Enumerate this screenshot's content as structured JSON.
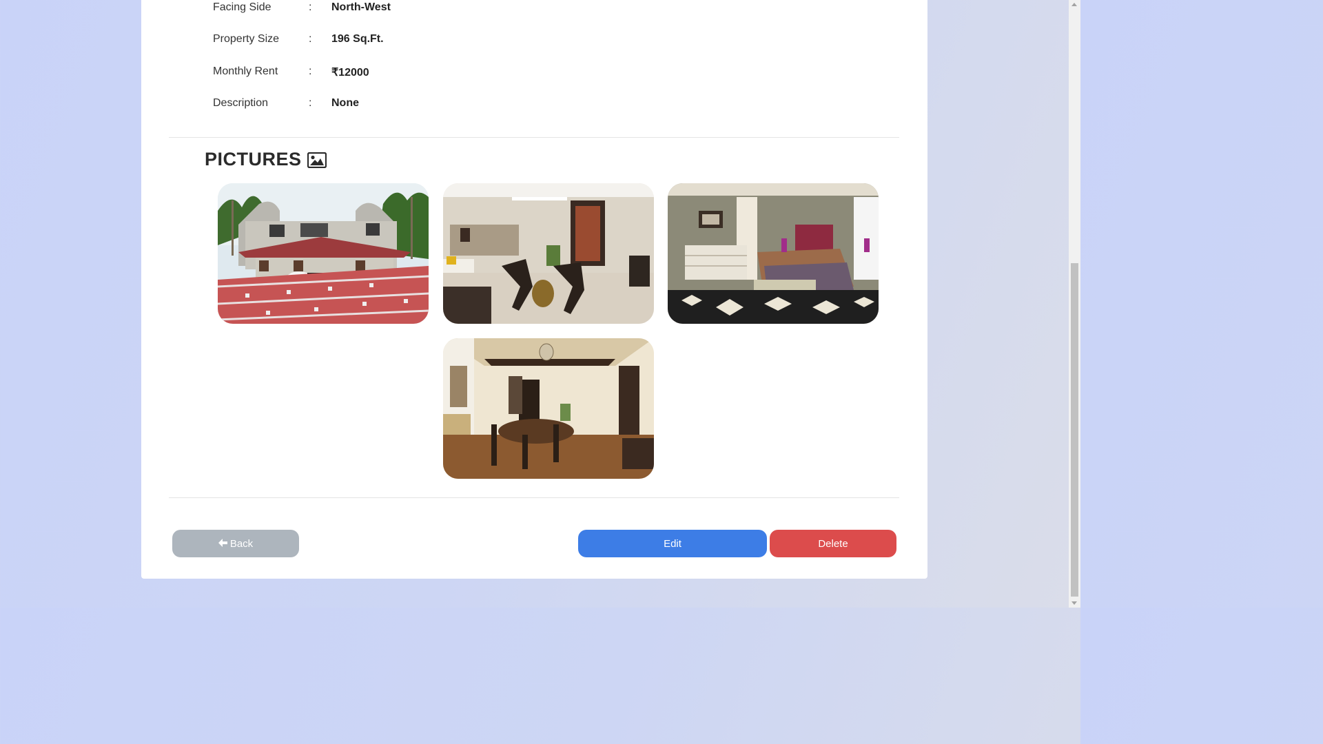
{
  "details": [
    {
      "label": "Facing Side",
      "colon": ":",
      "value": "North-West"
    },
    {
      "label": "Property Size",
      "colon": ":",
      "value": "196 Sq.Ft."
    },
    {
      "label": "Monthly Rent",
      "colon": ":",
      "value": "₹12000"
    },
    {
      "label": "Description",
      "colon": ":",
      "value": "None"
    }
  ],
  "pictures": {
    "title": "PICTURES",
    "icon": "image-icon",
    "images": [
      {
        "name": "house-exterior-photo"
      },
      {
        "name": "living-room-photo"
      },
      {
        "name": "bedroom-photo"
      },
      {
        "name": "dining-room-photo"
      }
    ]
  },
  "actions": {
    "back_label": "Back",
    "back_icon": "arrow-left-icon",
    "edit_label": "Edit",
    "delete_label": "Delete"
  },
  "colors": {
    "edit": "#3d7de6",
    "delete": "#dc4c4c",
    "back": "#adb5bd"
  }
}
